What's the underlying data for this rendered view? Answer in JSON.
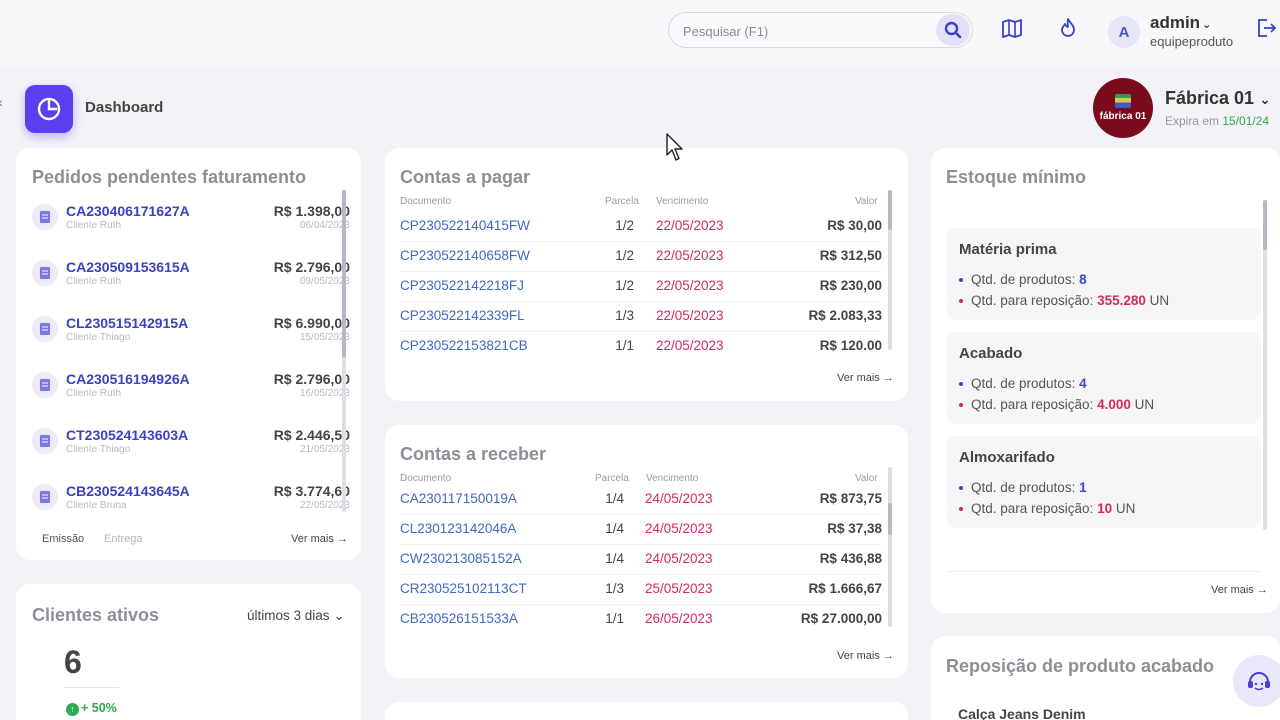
{
  "topbar": {
    "search_placeholder": "Pesquisar (F1)",
    "user_initial": "A",
    "user_name": "admin",
    "user_sub": "equipeproduto"
  },
  "page": {
    "title": "Dashboard"
  },
  "company": {
    "logo_text": "fábrica 01",
    "name": "Fábrica 01",
    "expires_label": "Expira em",
    "expires_date": "15/01/24"
  },
  "pedidos": {
    "title": "Pedidos pendentes faturamento",
    "items": [
      {
        "code": "CA230406171627A",
        "client": "Cliente Ruth",
        "value": "R$ 1.398,00",
        "date": "06/04/2023"
      },
      {
        "code": "CA230509153615A",
        "client": "Cliente Ruth",
        "value": "R$ 2.796,00",
        "date": "09/05/2023"
      },
      {
        "code": "CL230515142915A",
        "client": "Cliente Thiago",
        "value": "R$ 6.990,00",
        "date": "15/05/2023"
      },
      {
        "code": "CA230516194926A",
        "client": "Cliente Ruth",
        "value": "R$ 2.796,00",
        "date": "16/05/2023"
      },
      {
        "code": "CT230524143603A",
        "client": "Cliente Thiago",
        "value": "R$ 2.446,50",
        "date": "21/05/2023"
      },
      {
        "code": "CB230524143645A",
        "client": "Cliente Bruna",
        "value": "R$ 3.774,60",
        "date": "22/05/2023"
      }
    ],
    "tab_emissao": "Emissão",
    "tab_entrega": "Entrega",
    "ver_mais": "Ver mais"
  },
  "clientes": {
    "title": "Clientes ativos",
    "period": "últimos 3 dias",
    "count": "6",
    "change": "+ 50%"
  },
  "pagar": {
    "title": "Contas a pagar",
    "headers": {
      "doc": "Documento",
      "parcela": "Parcela",
      "venc": "Vencimento",
      "valor": "Valor"
    },
    "rows": [
      {
        "doc": "CP230522140415FW",
        "parcela": "1/2",
        "venc": "22/05/2023",
        "valor": "R$ 30,00"
      },
      {
        "doc": "CP230522140658FW",
        "parcela": "1/2",
        "venc": "22/05/2023",
        "valor": "R$ 312,50"
      },
      {
        "doc": "CP230522142218FJ",
        "parcela": "1/2",
        "venc": "22/05/2023",
        "valor": "R$ 230,00"
      },
      {
        "doc": "CP230522142339FL",
        "parcela": "1/3",
        "venc": "22/05/2023",
        "valor": "R$ 2.083,33"
      },
      {
        "doc": "CP230522153821CB",
        "parcela": "1/1",
        "venc": "22/05/2023",
        "valor": "R$ 120.00"
      }
    ],
    "ver_mais": "Ver mais"
  },
  "receber": {
    "title": "Contas a receber",
    "headers": {
      "doc": "Documento",
      "parcela": "Parcela",
      "venc": "Vencimento",
      "valor": "Valor"
    },
    "rows": [
      {
        "doc": "CA230117150019A",
        "parcela": "1/4",
        "venc": "24/05/2023",
        "valor": "R$ 873,75"
      },
      {
        "doc": "CL230123142046A",
        "parcela": "1/4",
        "venc": "24/05/2023",
        "valor": "R$ 37,38"
      },
      {
        "doc": "CW230213085152A",
        "parcela": "1/4",
        "venc": "24/05/2023",
        "valor": "R$ 436,88"
      },
      {
        "doc": "CR230525102113CT",
        "parcela": "1/3",
        "venc": "25/05/2023",
        "valor": "R$ 1.666,67"
      },
      {
        "doc": "CB230526151533A",
        "parcela": "1/1",
        "venc": "26/05/2023",
        "valor": "R$ 27.000,00"
      }
    ],
    "ver_mais": "Ver mais"
  },
  "estoque": {
    "title": "Estoque mínimo",
    "groups": [
      {
        "title": "Matéria prima",
        "produtos_label": "Qtd. de produtos:",
        "produtos": "8",
        "repos_label": "Qtd. para reposição:",
        "repos": "355.280",
        "unit": "UN"
      },
      {
        "title": "Acabado",
        "produtos_label": "Qtd. de produtos:",
        "produtos": "4",
        "repos_label": "Qtd. para reposição:",
        "repos": "4.000",
        "unit": "UN"
      },
      {
        "title": "Almoxarifado",
        "produtos_label": "Qtd. de produtos:",
        "produtos": "1",
        "repos_label": "Qtd. para reposição:",
        "repos": "10",
        "unit": "UN"
      }
    ],
    "ver_mais": "Ver mais"
  },
  "reposicao": {
    "title": "Reposição de produto acabado",
    "first_item": "Calça Jeans Denim"
  }
}
